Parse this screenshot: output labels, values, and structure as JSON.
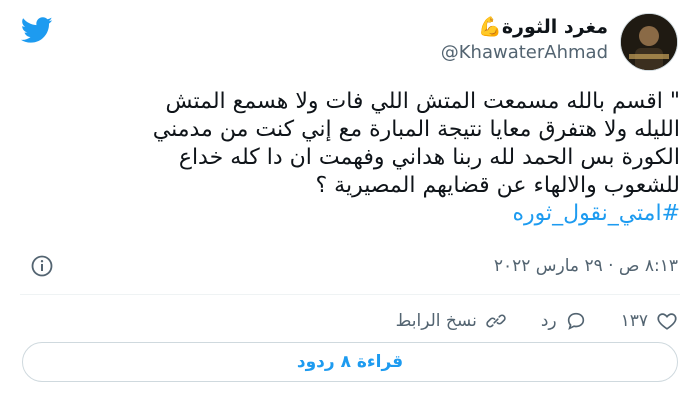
{
  "brand": {
    "icon": "twitter-bird-icon",
    "color": "#1d9bf0"
  },
  "author": {
    "display_name": "مغرد الثورة💪",
    "handle": "@KhawaterAhmad",
    "avatar_icon": "profile-photo"
  },
  "tweet": {
    "text": "\" اقسم بالله مسمعت المتش اللي فات ولا هسمع المتش\nالليله ولا هتفرق معايا نتيجة المبارة مع إني كنت من مدمني\nالكورة بس الحمد لله ربنا هداني وفهمت ان دا كله خداع\nللشعوب والالهاء عن قضايهم المصيرية ؟",
    "hashtag": "#امتي_نقول_ثوره"
  },
  "meta": {
    "timestamp": "٨:١٣ ص · ٢٩ مارس ٢٠٢٢",
    "info_icon": "info-icon"
  },
  "actions": {
    "like_count": "١٣٧",
    "reply_label": "رد",
    "copy_link_label": "نسخ الرابط"
  },
  "read_replies_label": "قراءة ٨ ردود",
  "colors": {
    "accent": "#1d9bf0",
    "text": "#0f1419",
    "muted": "#536471",
    "border": "#cfd9de"
  }
}
